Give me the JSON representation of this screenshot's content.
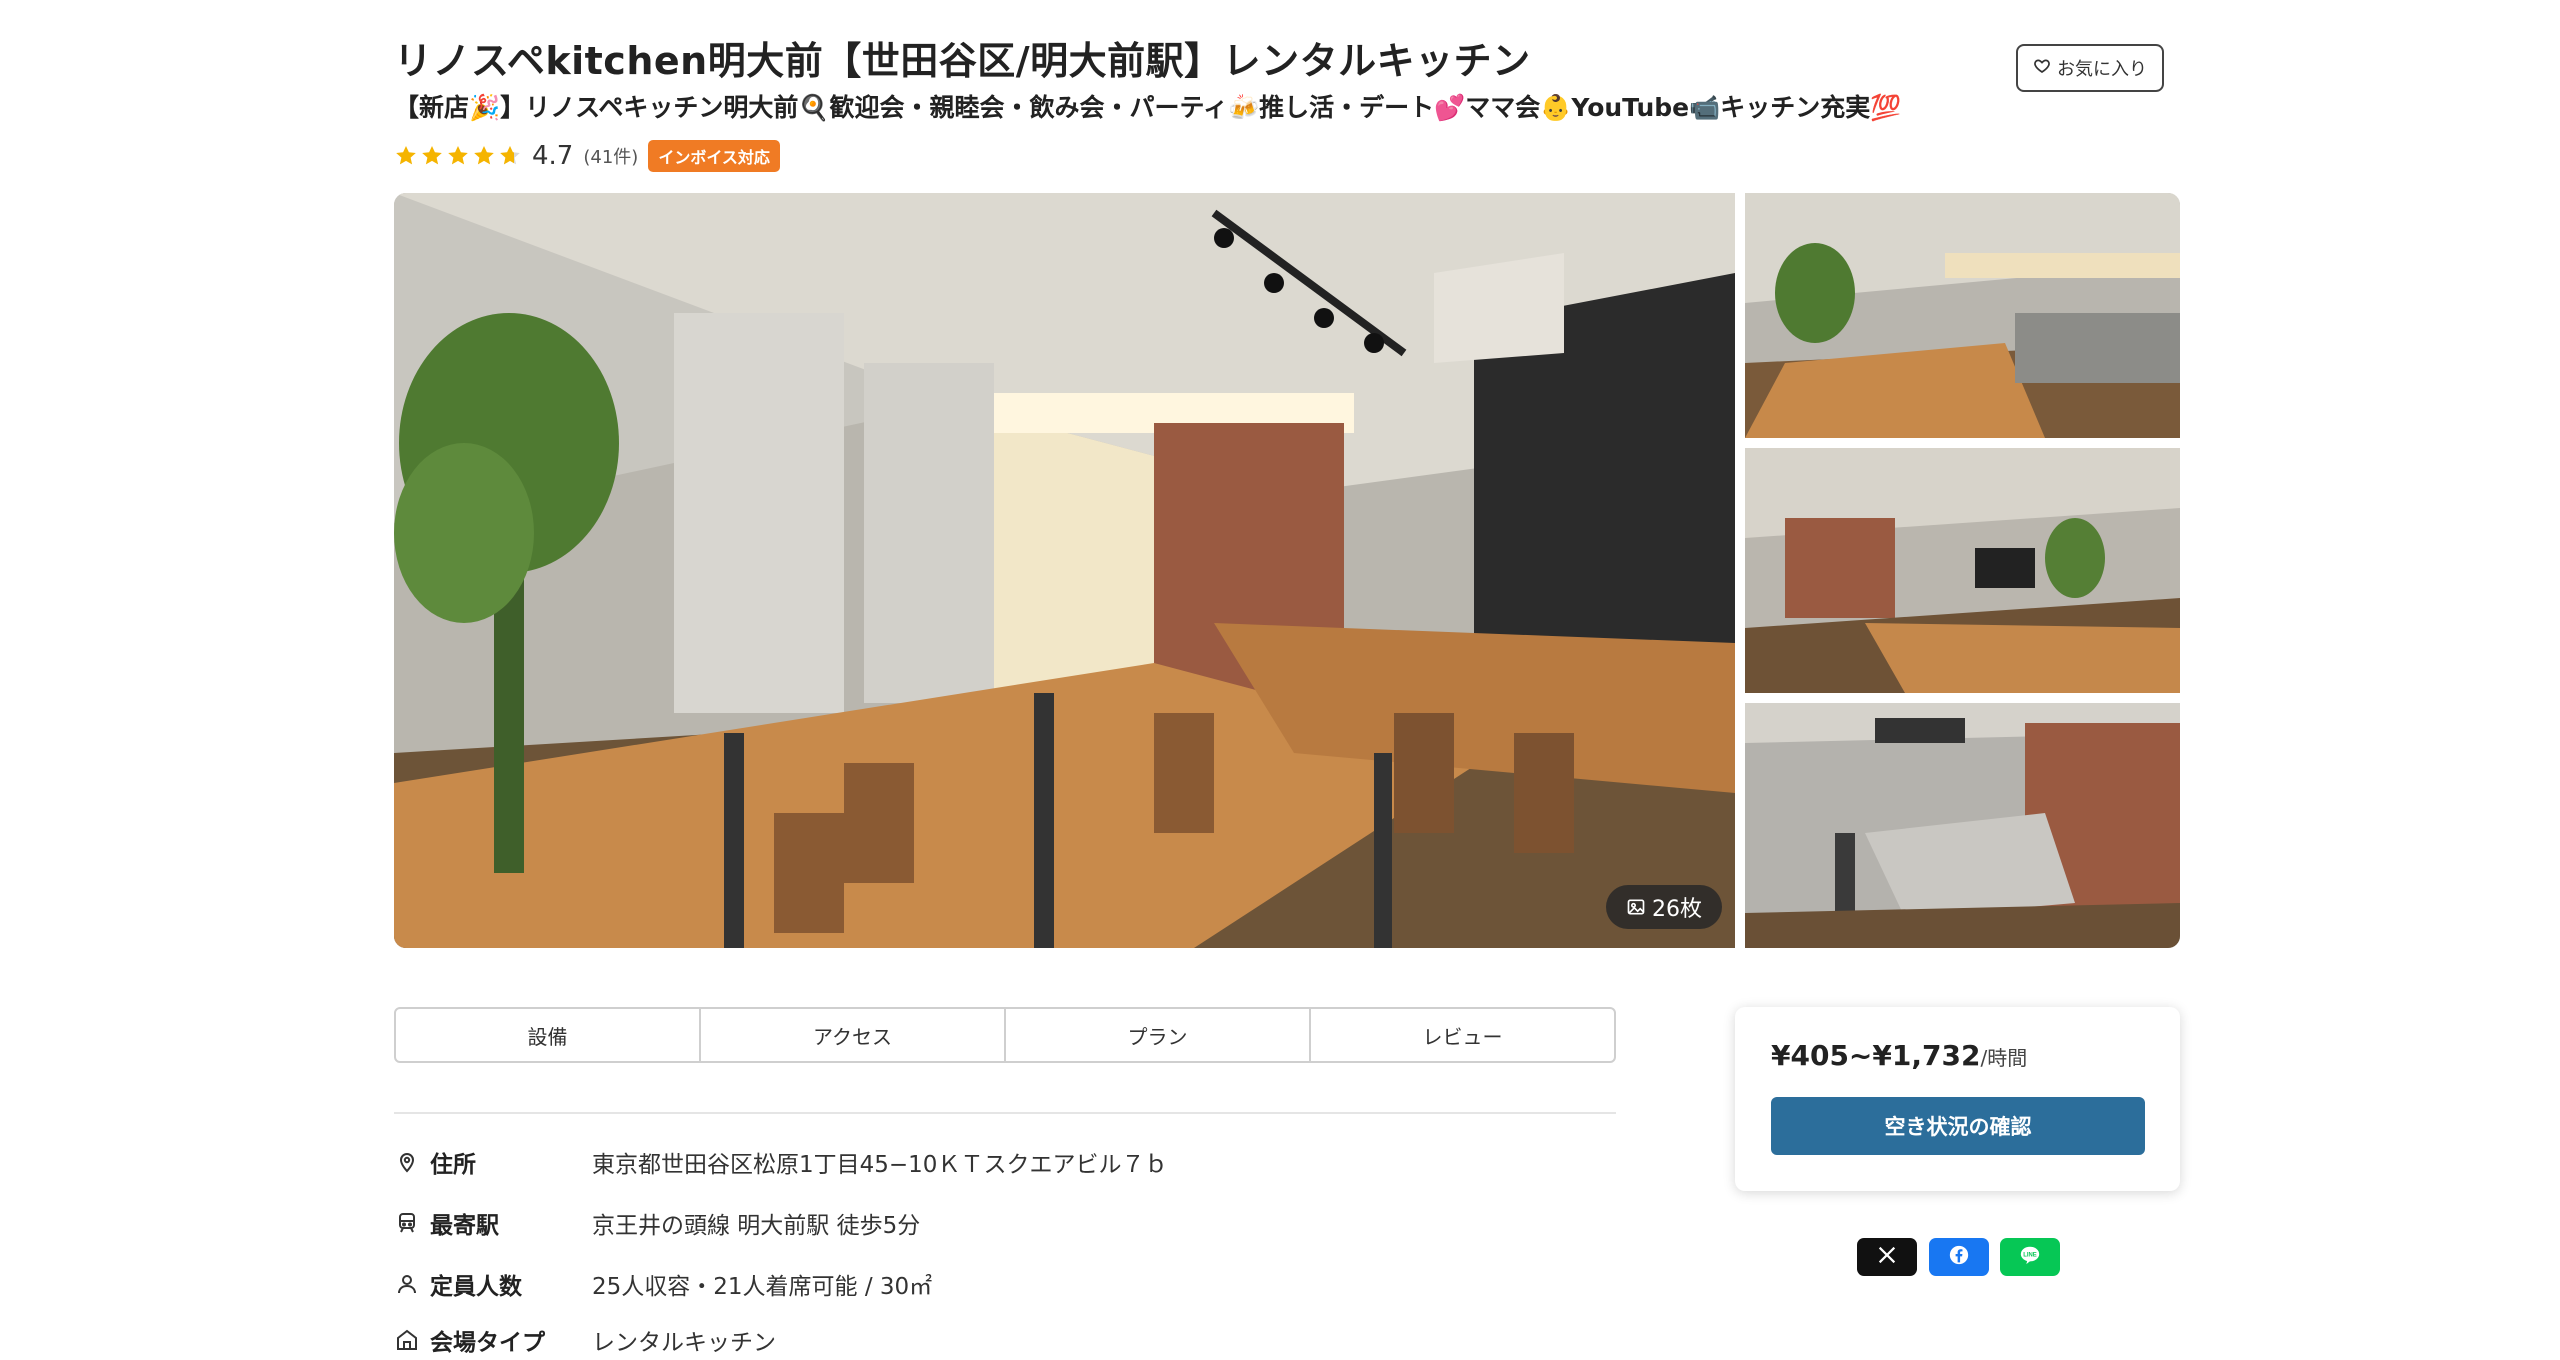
{
  "listing": {
    "title": "リノスペkitchen明大前【世田谷区/明大前駅】レンタルキッチン",
    "subtitle": "【新店🎉】リノスペキッチン明大前🍳歓迎会・親睦会・飲み会・パーティ🍻推し活・デート💕ママ会👶YouTube📹キッチン充実💯",
    "favorite_label": "お気に入り",
    "rating": "4.7",
    "rating_stars": 4.7,
    "review_count": "(41件)",
    "invoice_badge": "インボイス対応"
  },
  "gallery": {
    "photo_count": "26枚"
  },
  "tabs": [
    "設備",
    "アクセス",
    "プラン",
    "レビュー"
  ],
  "info": {
    "address": {
      "label": "住所",
      "value": "東京都世田谷区松原1丁目45−10ＫＴスクエアビル７ｂ"
    },
    "station": {
      "label": "最寄駅",
      "value": "京王井の頭線 明大前駅 徒歩5分"
    },
    "capacity": {
      "label": "定員人数",
      "value": "25人収容・21人着席可能 / 30㎡"
    },
    "venue_type": {
      "label": "会場タイプ",
      "value": "レンタルキッチン"
    }
  },
  "booking": {
    "price": "¥405~¥1,732",
    "price_unit": "/時間",
    "cta_label": "空き状況の確認"
  },
  "colors": {
    "star": "#f5b400",
    "badge": "#f07b24",
    "cta": "#2c6e9b",
    "x": "#111111",
    "facebook": "#1877f2",
    "line": "#06c755"
  }
}
